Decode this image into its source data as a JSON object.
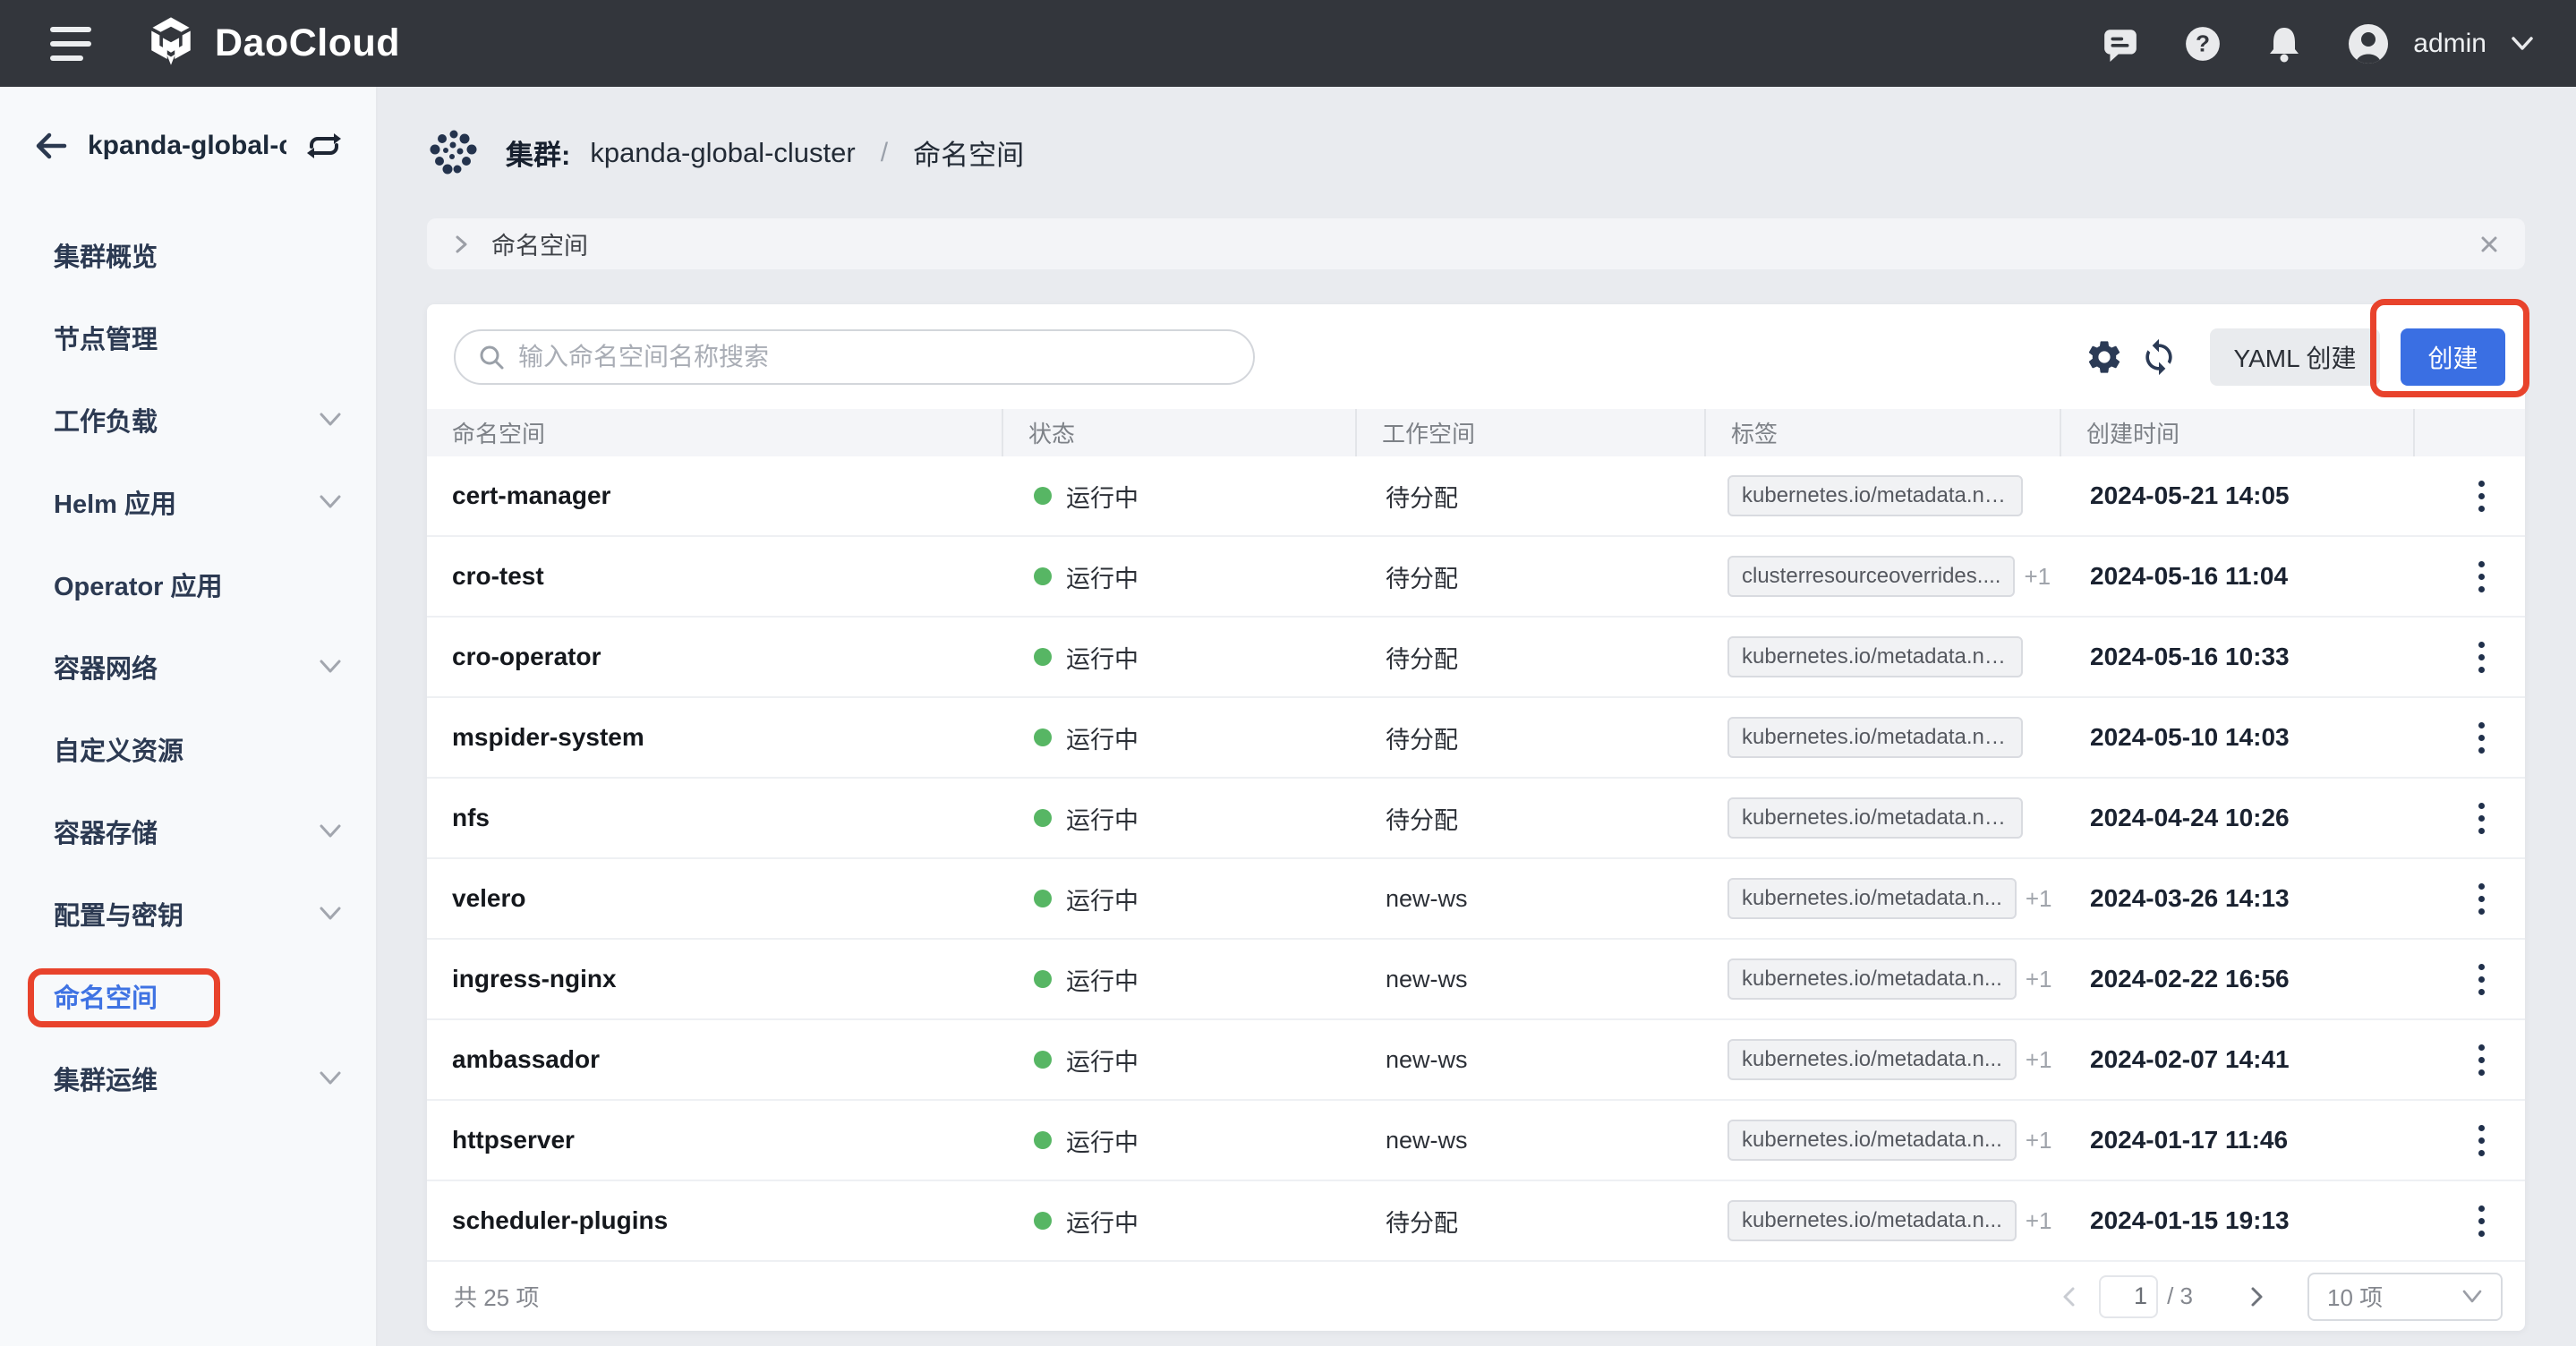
{
  "topbar": {
    "logo_text": "DaoCloud",
    "user": "admin"
  },
  "sidebar": {
    "cluster_name": "kpanda-global-cl...",
    "items": [
      {
        "label": "集群概览",
        "chevron": false,
        "active": false
      },
      {
        "label": "节点管理",
        "chevron": false,
        "active": false
      },
      {
        "label": "工作负载",
        "chevron": true,
        "active": false
      },
      {
        "label": "Helm 应用",
        "chevron": true,
        "active": false
      },
      {
        "label": "Operator 应用",
        "chevron": false,
        "active": false
      },
      {
        "label": "容器网络",
        "chevron": true,
        "active": false
      },
      {
        "label": "自定义资源",
        "chevron": false,
        "active": false
      },
      {
        "label": "容器存储",
        "chevron": true,
        "active": false
      },
      {
        "label": "配置与密钥",
        "chevron": true,
        "active": false
      },
      {
        "label": "命名空间",
        "chevron": false,
        "active": true
      },
      {
        "label": "集群运维",
        "chevron": true,
        "active": false
      }
    ]
  },
  "breadcrumb": {
    "prefix": "集群:",
    "cluster": "kpanda-global-cluster",
    "separator": "/",
    "current": "命名空间"
  },
  "tab_bar": {
    "title": "命名空间"
  },
  "toolbar": {
    "search_placeholder": "输入命名空间名称搜索",
    "yaml_create_label": "YAML 创建",
    "create_label": "创建"
  },
  "table": {
    "columns": [
      "命名空间",
      "状态",
      "工作空间",
      "标签",
      "创建时间"
    ],
    "rows": [
      {
        "name": "cert-manager",
        "status": "运行中",
        "workspace": "待分配",
        "label_tag": "kubernetes.io/metadata.nam...",
        "extra": "",
        "created": "2024-05-21 14:05"
      },
      {
        "name": "cro-test",
        "status": "运行中",
        "workspace": "待分配",
        "label_tag": "clusterresourceoverrides....",
        "extra": "+1",
        "created": "2024-05-16 11:04"
      },
      {
        "name": "cro-operator",
        "status": "运行中",
        "workspace": "待分配",
        "label_tag": "kubernetes.io/metadata.nam...",
        "extra": "",
        "created": "2024-05-16 10:33"
      },
      {
        "name": "mspider-system",
        "status": "运行中",
        "workspace": "待分配",
        "label_tag": "kubernetes.io/metadata.nam...",
        "extra": "",
        "created": "2024-05-10 14:03"
      },
      {
        "name": "nfs",
        "status": "运行中",
        "workspace": "待分配",
        "label_tag": "kubernetes.io/metadata.nam...",
        "extra": "",
        "created": "2024-04-24 10:26"
      },
      {
        "name": "velero",
        "status": "运行中",
        "workspace": "new-ws",
        "label_tag": "kubernetes.io/metadata.n...",
        "extra": "+1",
        "created": "2024-03-26 14:13"
      },
      {
        "name": "ingress-nginx",
        "status": "运行中",
        "workspace": "new-ws",
        "label_tag": "kubernetes.io/metadata.n...",
        "extra": "+1",
        "created": "2024-02-22 16:56"
      },
      {
        "name": "ambassador",
        "status": "运行中",
        "workspace": "new-ws",
        "label_tag": "kubernetes.io/metadata.n...",
        "extra": "+1",
        "created": "2024-02-07 14:41"
      },
      {
        "name": "httpserver",
        "status": "运行中",
        "workspace": "new-ws",
        "label_tag": "kubernetes.io/metadata.n...",
        "extra": "+1",
        "created": "2024-01-17 11:46"
      },
      {
        "name": "scheduler-plugins",
        "status": "运行中",
        "workspace": "待分配",
        "label_tag": "kubernetes.io/metadata.n...",
        "extra": "+1",
        "created": "2024-01-15 19:13"
      }
    ]
  },
  "pagination": {
    "total": "共 25 项",
    "page": "1",
    "total_pages": "/ 3",
    "page_size": "10 项"
  },
  "colors": {
    "accent_blue": "#3a6fe3",
    "annotation_red": "#e8432c",
    "status_green": "#57b664",
    "topbar_bg": "#33363c"
  }
}
